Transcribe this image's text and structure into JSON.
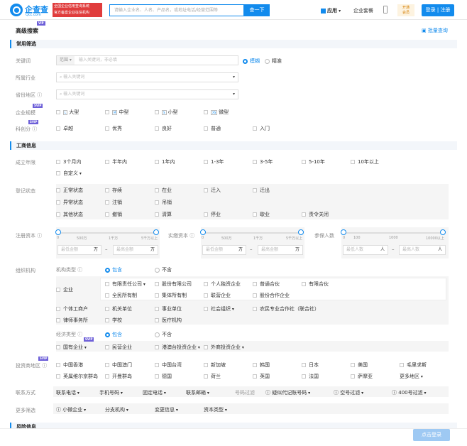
{
  "header": {
    "logo_text": "企查查",
    "logo_sub": "Qcc.com",
    "badge_line1": "全国企业信用查询系统",
    "badge_line2": "官方备案企业征信机构",
    "search_placeholder": "请输入企业名、人名、产品名，或地址电话/经营范围等",
    "search_button": "查一下",
    "app_label": "应用",
    "enterprise_kit": "企业套餐",
    "vip_line1": "开通",
    "vip_line2": "会员",
    "login_label": "登录 | 注册"
  },
  "page": {
    "title": "高级搜索",
    "vip": "VIP",
    "svip": "SVIP",
    "batch_query": "批量查询"
  },
  "common": {
    "section_title": "常用筛选",
    "keyword_label": "关键词",
    "keyword_scope": "范围",
    "keyword_placeholder": "输入关键词，非必填",
    "fuzzy": "模糊",
    "exact": "精准",
    "industry_label": "所属行业",
    "industry_placeholder": "输入关键词",
    "region_label": "省份地区",
    "region_placeholder": "输入关键词",
    "scale_label": "企业规模",
    "scale_options": [
      {
        "tag": "L",
        "label": "大型"
      },
      {
        "tag": "M",
        "label": "中型"
      },
      {
        "tag": "S",
        "label": "小型"
      },
      {
        "tag": "XS",
        "label": "微型"
      }
    ],
    "tech_label": "科创分",
    "tech_options": [
      "卓越",
      "优秀",
      "良好",
      "普通",
      "入门"
    ]
  },
  "business": {
    "section_title": "工商信息",
    "established_label": "成立年限",
    "established_options": [
      "3个月内",
      "半年内",
      "1年内",
      "1-3年",
      "3-5年",
      "5-10年",
      "10年以上"
    ],
    "custom": "自定义",
    "status_label": "登记状态",
    "status_row1": [
      "正常状态",
      "存续",
      "在业",
      "迁入",
      "迁出"
    ],
    "status_row2": [
      "异常状态",
      "注销",
      "吊销"
    ],
    "status_row3": [
      "其他状态",
      "撤销",
      "清算",
      "停业",
      "歇业",
      "责令关闭"
    ],
    "capital_label": "注册资本",
    "capital_ticks": [
      "0",
      "500万",
      "1千万",
      "5千万以上"
    ],
    "capital_min": "最低金额",
    "capital_max": "最高金额",
    "capital_unit": "万",
    "paid_label": "实缴资本",
    "paid_ticks": [
      "0",
      "500万",
      "1千万",
      "5千万以上"
    ],
    "insured_label": "参保人数",
    "insured_ticks": [
      "0",
      "100",
      "1000",
      "10000以上"
    ],
    "insured_min": "最低人数",
    "insured_max": "最高人数",
    "insured_unit": "人",
    "org_label": "组织机构",
    "org_type_label": "机构类型",
    "include": "包含",
    "exclude": "不含",
    "enterprise": "企业",
    "ent_row1": [
      "有限责任公司",
      "股份有限公司",
      "个人独资企业",
      "普通合伙",
      "有限合伙"
    ],
    "ent_row2": [
      "全民所有制",
      "集体所有制",
      "联营企业",
      "股份合作企业"
    ],
    "org_row": [
      "个体工商户",
      "机关单位",
      "事业单位",
      "社会组织",
      "农民专业合作社（联合社）"
    ],
    "org_row2": [
      "律师事务所",
      "学校",
      "医疗机构"
    ],
    "econ_label": "经济类型",
    "econ_options": [
      "国有企业",
      "民营企业",
      "港澳台投资企业",
      "外商投资企业"
    ],
    "invest_label": "投资商地区",
    "invest_row1": [
      "中国香港",
      "中国澳门",
      "中国台湾",
      "新加坡",
      "韩国",
      "日本",
      "美国",
      "毛里求斯"
    ],
    "invest_row2": [
      "英属维尔京群岛",
      "开曼群岛",
      "德国",
      "荷兰",
      "英国",
      "法国",
      "萨摩亚",
      "更多地区"
    ],
    "contact_label": "联系方式",
    "contact_options": [
      "联系电话",
      "手机号码",
      "固定电话",
      "联系邮箱"
    ],
    "filter_label": "号码过滤",
    "filter_options": [
      "疑似代记账号码",
      "空号过滤",
      "400号过滤"
    ],
    "more_label": "更多筛选",
    "more_options": [
      "小微企业",
      "分支机构",
      "变更信息",
      "资本类型"
    ]
  },
  "footer": {
    "section_peek": "风险信息",
    "submit": "点击登录"
  }
}
